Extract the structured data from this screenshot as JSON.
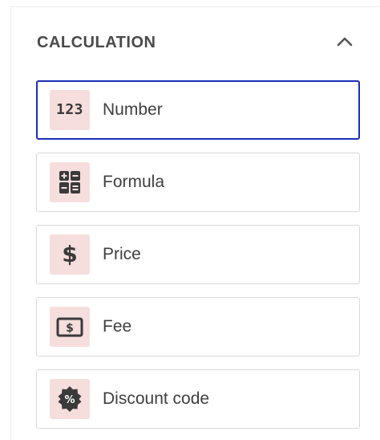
{
  "section": {
    "title": "CALCULATION",
    "toggle_icon": "chevron-up-icon"
  },
  "items": [
    {
      "label": "Number",
      "icon": "number-123-icon",
      "icon_text": "123",
      "active": true
    },
    {
      "label": "Formula",
      "icon": "calculator-icon",
      "active": false
    },
    {
      "label": "Price",
      "icon": "dollar-icon",
      "icon_text": "$",
      "active": false
    },
    {
      "label": "Fee",
      "icon": "banknote-icon",
      "active": false
    },
    {
      "label": "Discount code",
      "icon": "percent-badge-icon",
      "active": false
    }
  ],
  "colors": {
    "icon_tile_bg": "#f6dedd",
    "active_border": "#1a2fb8",
    "text": "#3f3f3f"
  }
}
